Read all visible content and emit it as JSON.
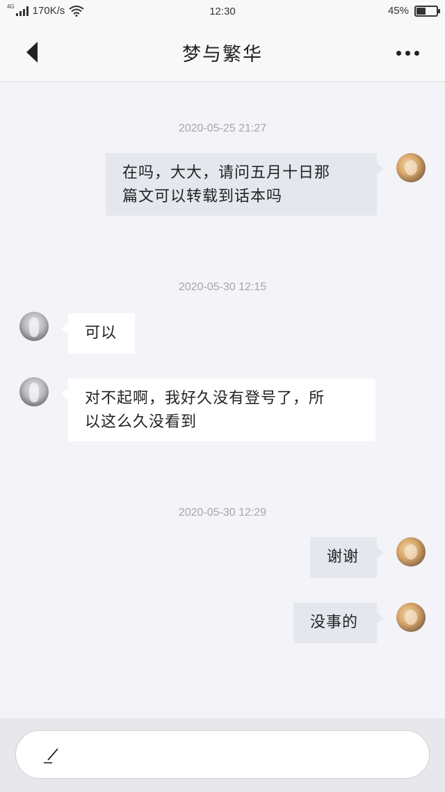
{
  "status_bar": {
    "network_type": "4G",
    "speed": "170K/s",
    "time": "12:30",
    "battery_percent": "45%",
    "battery_level": 0.45,
    "icons": [
      "signal-icon",
      "wifi-icon",
      "battery-icon"
    ]
  },
  "header": {
    "title": "梦与繁华",
    "back_icon": "back-arrow-icon",
    "more_icon": "more-icon"
  },
  "messages": [
    {
      "type": "timestamp",
      "text": "2020-05-25 21:27"
    },
    {
      "type": "message",
      "sender": "me",
      "text_lines": [
        "在吗，大大，请问五月十日那",
        "篇文可以转载到话本吗"
      ]
    },
    {
      "type": "timestamp",
      "text": "2020-05-30 12:15"
    },
    {
      "type": "message",
      "sender": "other",
      "text_lines": [
        "可以"
      ]
    },
    {
      "type": "message",
      "sender": "other",
      "text_lines": [
        "对不起啊，我好久没有登号了，所",
        "以这么久没看到"
      ]
    },
    {
      "type": "timestamp",
      "text": "2020-05-30 12:29"
    },
    {
      "type": "message",
      "sender": "me",
      "text_lines": [
        "谢谢"
      ]
    },
    {
      "type": "message",
      "sender": "me",
      "text_lines": [
        "没事的"
      ]
    }
  ],
  "input": {
    "icon": "pen-icon"
  },
  "colors": {
    "background": "#f3f3f8",
    "bubble_me": "#e4e8ee",
    "bubble_other": "#ffffff",
    "timestamp": "#a6a6ab"
  }
}
